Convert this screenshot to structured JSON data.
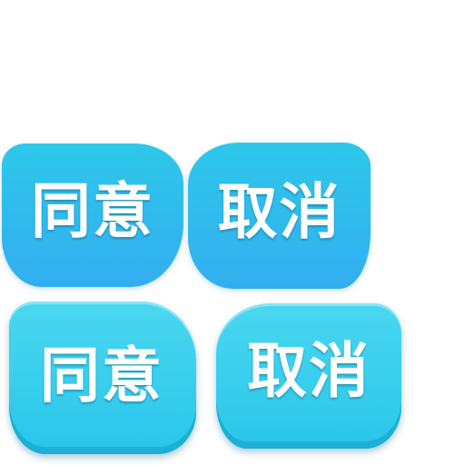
{
  "buttons": {
    "row1": {
      "agree_label": "同意",
      "cancel_label": "取消"
    },
    "row2": {
      "agree_label": "同意",
      "cancel_label": "取消"
    }
  },
  "colors": {
    "row1_fill_top": "#2ec8ea",
    "row1_fill_bottom": "#32aef0",
    "row2_fill_top": "#4ad7f0",
    "row2_fill_bottom": "#29c6ea",
    "label_text": "#ffffff",
    "background": "#ffffff"
  }
}
